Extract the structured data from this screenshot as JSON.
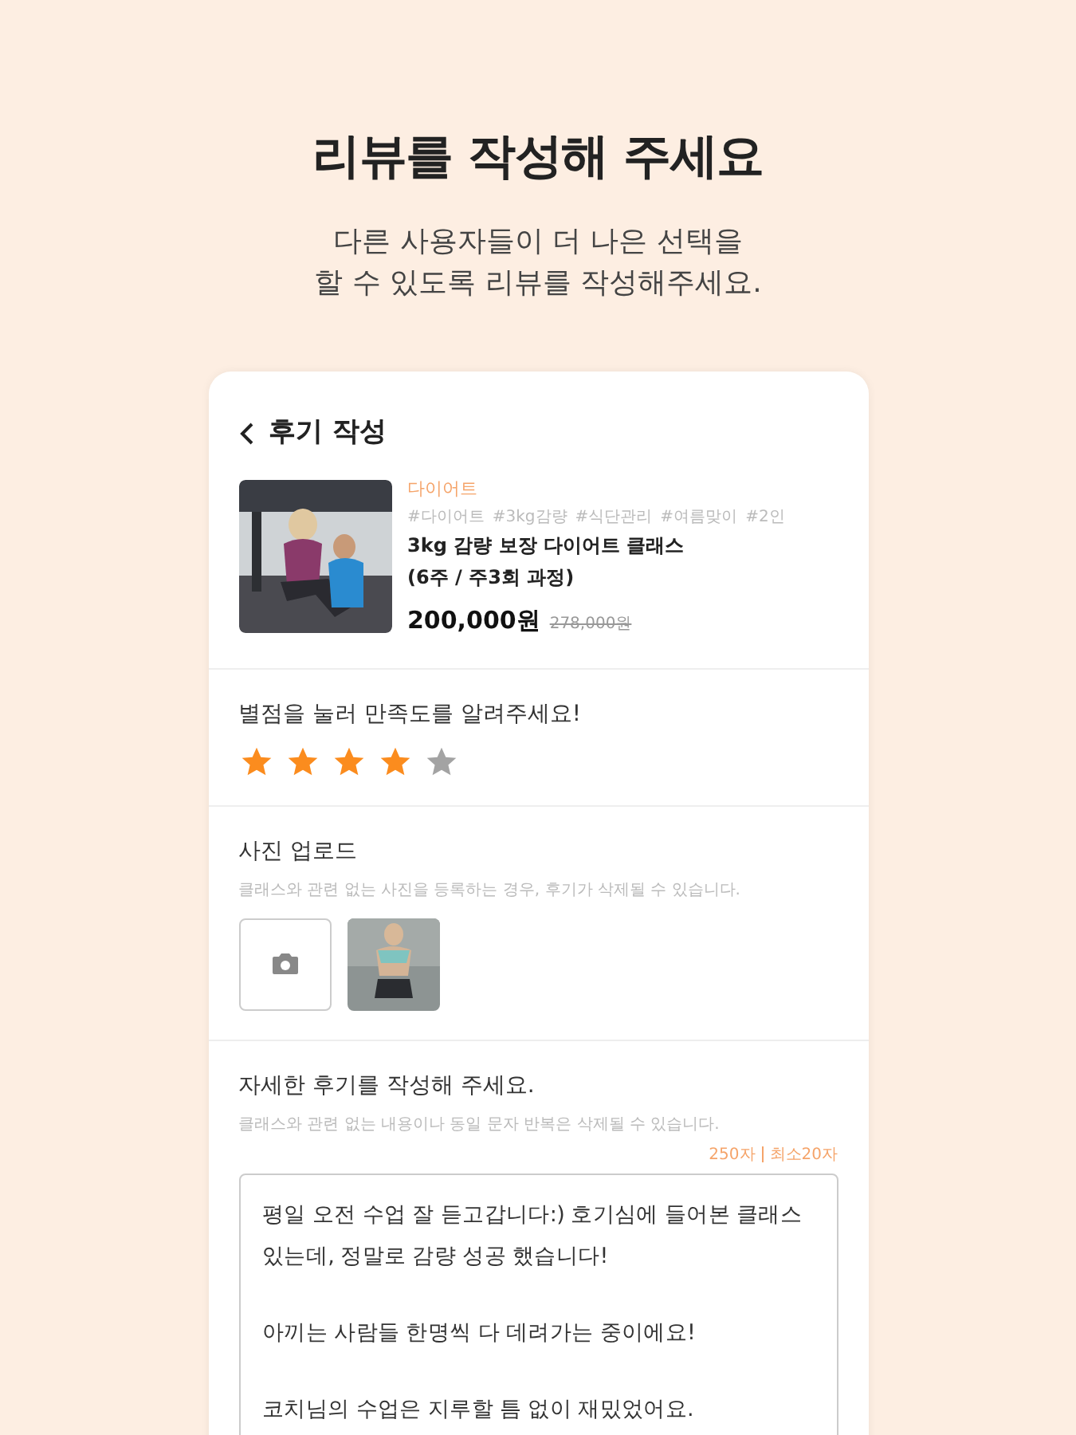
{
  "heading": "리뷰를 작성해 주세요",
  "subheading": [
    "다른 사용자들이 더 나은 선택을",
    "할 수 있도록 리뷰를 작성해주세요."
  ],
  "screen": {
    "title": "후기 작성",
    "product": {
      "category": "다이어트",
      "tags": [
        "#다이어트",
        "#3kg감량",
        "#식단관리",
        "#여름맞이",
        "#2인"
      ],
      "name": [
        "3kg 감량 보장 다이어트 클래스",
        "(6주 / 주3회 과정)"
      ],
      "price": "200,000원",
      "original_price": "278,000원"
    },
    "rating": {
      "label": "별점을 눌러 만족도를 알려주세요!",
      "stars": 4
    },
    "photos": {
      "label": "사진 업로드",
      "hint": "클래스와 관련 없는 사진을 등록하는 경우, 후기가 삭제될 수 있습니다.",
      "items": [
        {
          "kind": "add"
        },
        {
          "kind": "picture"
        }
      ]
    },
    "review": {
      "label": "자세한 후기를 작성해 주세요.",
      "hint": "클래스와 관련 없는 내용이나 동일 문자 반복은 삭제될 수 있습니다.",
      "count": "250자",
      "minimum": "최소20자",
      "paragraphs": [
        "평일 오전 수업 잘 듣고갑니다:) 호기심에 들어본 클래스 있는데, 정말로 감량 성공 했습니다!",
        "아끼는 사람들 한명씩 다 데려가는 중이에요!",
        "코치님의 수업은 지루할 틈 없이 재밌었어요."
      ]
    }
  }
}
